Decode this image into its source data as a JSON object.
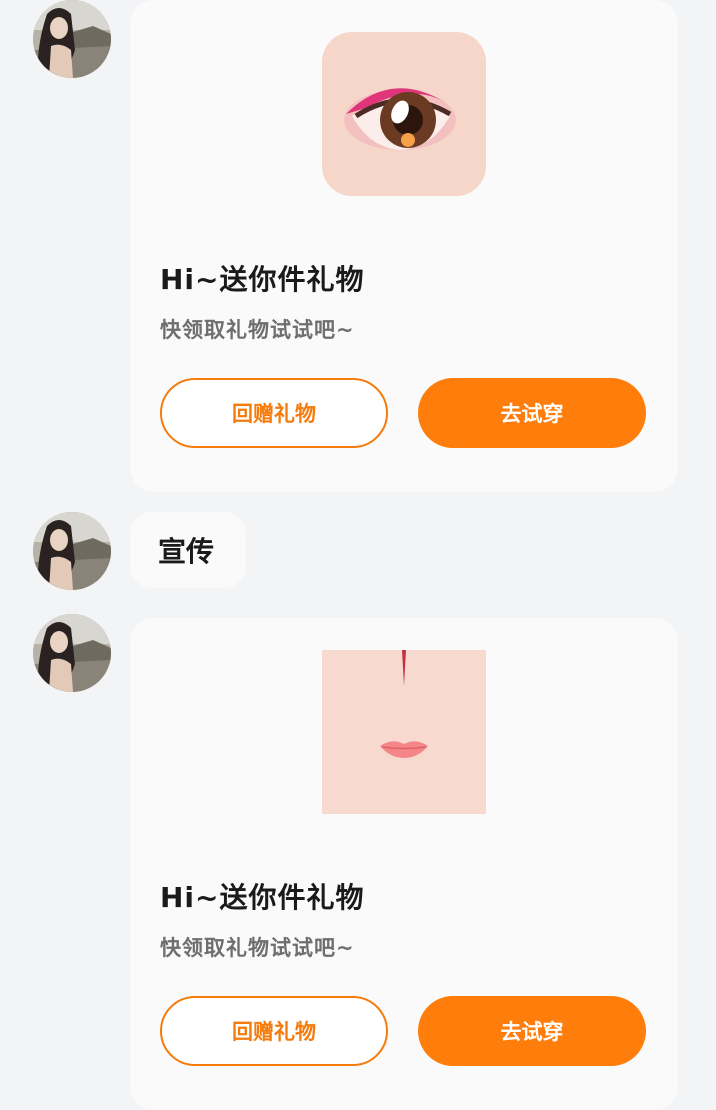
{
  "messages": [
    {
      "type": "gift",
      "gift_item": "eye-makeup-icon",
      "title": "Hi~送你件礼物",
      "subtitle": "快领取礼物试试吧~",
      "return_gift_label": "回赠礼物",
      "try_on_label": "去试穿"
    },
    {
      "type": "text",
      "text": "宣传"
    },
    {
      "type": "gift",
      "gift_item": "lip-makeup-icon",
      "title": "Hi~送你件礼物",
      "subtitle": "快领取礼物试试吧~",
      "return_gift_label": "回赠礼物",
      "try_on_label": "去试穿"
    }
  ],
  "colors": {
    "background": "#f3f4f6",
    "card": "#fafafa",
    "accent": "#ff7d0b",
    "title": "#1a1a1a",
    "subtitle": "#6e6e6e"
  }
}
